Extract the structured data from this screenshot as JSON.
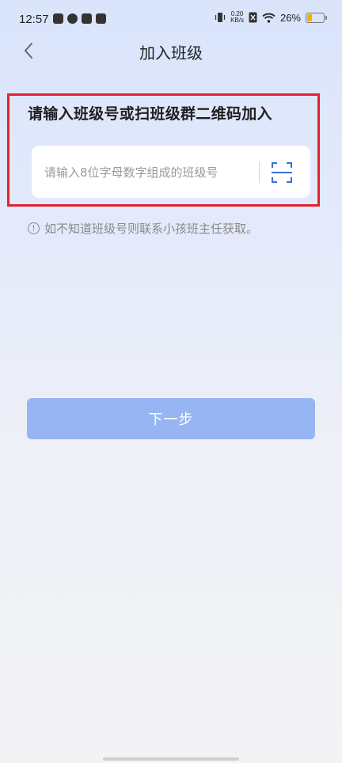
{
  "status_bar": {
    "time": "12:57",
    "net_speed_value": "0.20",
    "net_speed_unit": "KB/s",
    "battery_percent": "26%",
    "battery_level": 0.26,
    "left_icons": [
      "app-notification-icon",
      "cloud-icon",
      "tiktok-icon",
      "shopping-bag-icon"
    ],
    "right_icons": [
      "vibrate-icon",
      "no-sim-icon",
      "wifi-icon",
      "battery-icon"
    ]
  },
  "header": {
    "title": "加入班级",
    "back_icon": "chevron-left-icon"
  },
  "form": {
    "instruction": "请输入班级号或扫班级群二维码加入",
    "input_placeholder": "请输入8位字母数字组成的班级号",
    "input_value": "",
    "scan_icon": "scan-icon"
  },
  "hint": {
    "icon": "info-icon",
    "text": "如不知道班级号则联系小孩班主任获取。"
  },
  "actions": {
    "next_label": "下一步"
  },
  "colors": {
    "accent": "#97b5f2",
    "highlight": "#e0232e",
    "scan_icon": "#3b6fd6"
  }
}
